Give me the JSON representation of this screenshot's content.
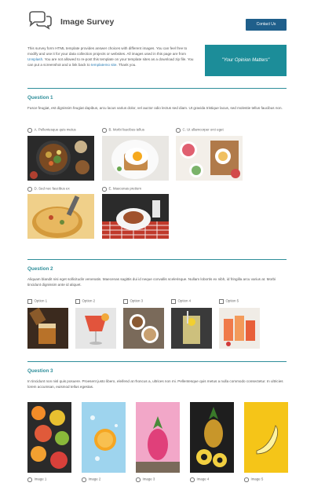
{
  "header": {
    "title": "Image Survey",
    "contact_label": "Contact Us"
  },
  "intro": {
    "text_1": "This survey form HTML template provides answer choices with different images. You can feel free to modify and use it for your data collection projects or websites. All images used in this page are from ",
    "link_unsplash": "Unsplash",
    "text_2": ". You are not allowed to re-post this template on your template sites as a download zip file. You can put a screenshot and a link back to ",
    "link_templatemo": "templatemo site",
    "text_3": ". Thank you.",
    "quote": "\"Your Opinion Matters\""
  },
  "question1": {
    "title": "Question 1",
    "desc": "Fusce feugiat, est dignissim feugiat dapibus, arcu lacus varius dolor, vel auctor odio lectus sed diam. Ut gravida tristique lacus, sed molestie tellus faucibus non.",
    "options": [
      "A. Pellentesque quis metus",
      "B. Morbi faucibus tellus",
      "C. Ut ullamcorper orci eget",
      "D. Sed nec faucibus ex",
      "E. Maecenas pretium"
    ]
  },
  "question2": {
    "title": "Question 2",
    "desc": "Aliquam blandit nisi eget sollicitudin venenatis. Maecenas sagittis dui id neque convallis scelerisque. Nullam lobortis ex nibh, id fringilla arcu varius at. Morbi tincidunt dignissim ante id aliquet.",
    "options": [
      "Option 1",
      "Option 2",
      "Option 3",
      "Option 4",
      "Option 5"
    ]
  },
  "question3": {
    "title": "Question 3",
    "desc": "In tincidunt non nisl quis posuere. Proesent justo libero, eleifend at rhoncus a, ultrices non mi. Pellentesque quis metus a nulla commodo consectetur. In ultricies lorem accumsan, euismod tellus egestas.",
    "options": [
      "Image 1",
      "Image 2",
      "Image 3",
      "Image 4",
      "Image 5"
    ]
  },
  "colors": {
    "accent": "#2e8e9a",
    "button": "#1f5f8b",
    "quote_bg": "#1c8d99"
  }
}
